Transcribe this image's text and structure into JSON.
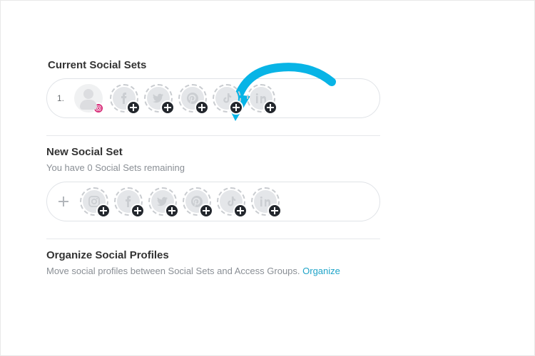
{
  "current": {
    "title": "Current Social Sets",
    "index_label": "1.",
    "slots": [
      "facebook",
      "twitter",
      "pinterest",
      "tiktok",
      "linkedin"
    ],
    "avatar_badge": "instagram"
  },
  "newset": {
    "title": "New Social Set",
    "remaining_text": "You have 0 Social Sets remaining",
    "slots": [
      "instagram",
      "facebook",
      "twitter",
      "pinterest",
      "tiktok",
      "linkedin"
    ]
  },
  "organize": {
    "title": "Organize Social Profiles",
    "text": "Move social profiles between Social Sets and Access Groups. ",
    "link": "Organize"
  },
  "colors": {
    "accent": "#08b4e6",
    "ig": "#d62976",
    "plus_bg": "#23272d"
  }
}
